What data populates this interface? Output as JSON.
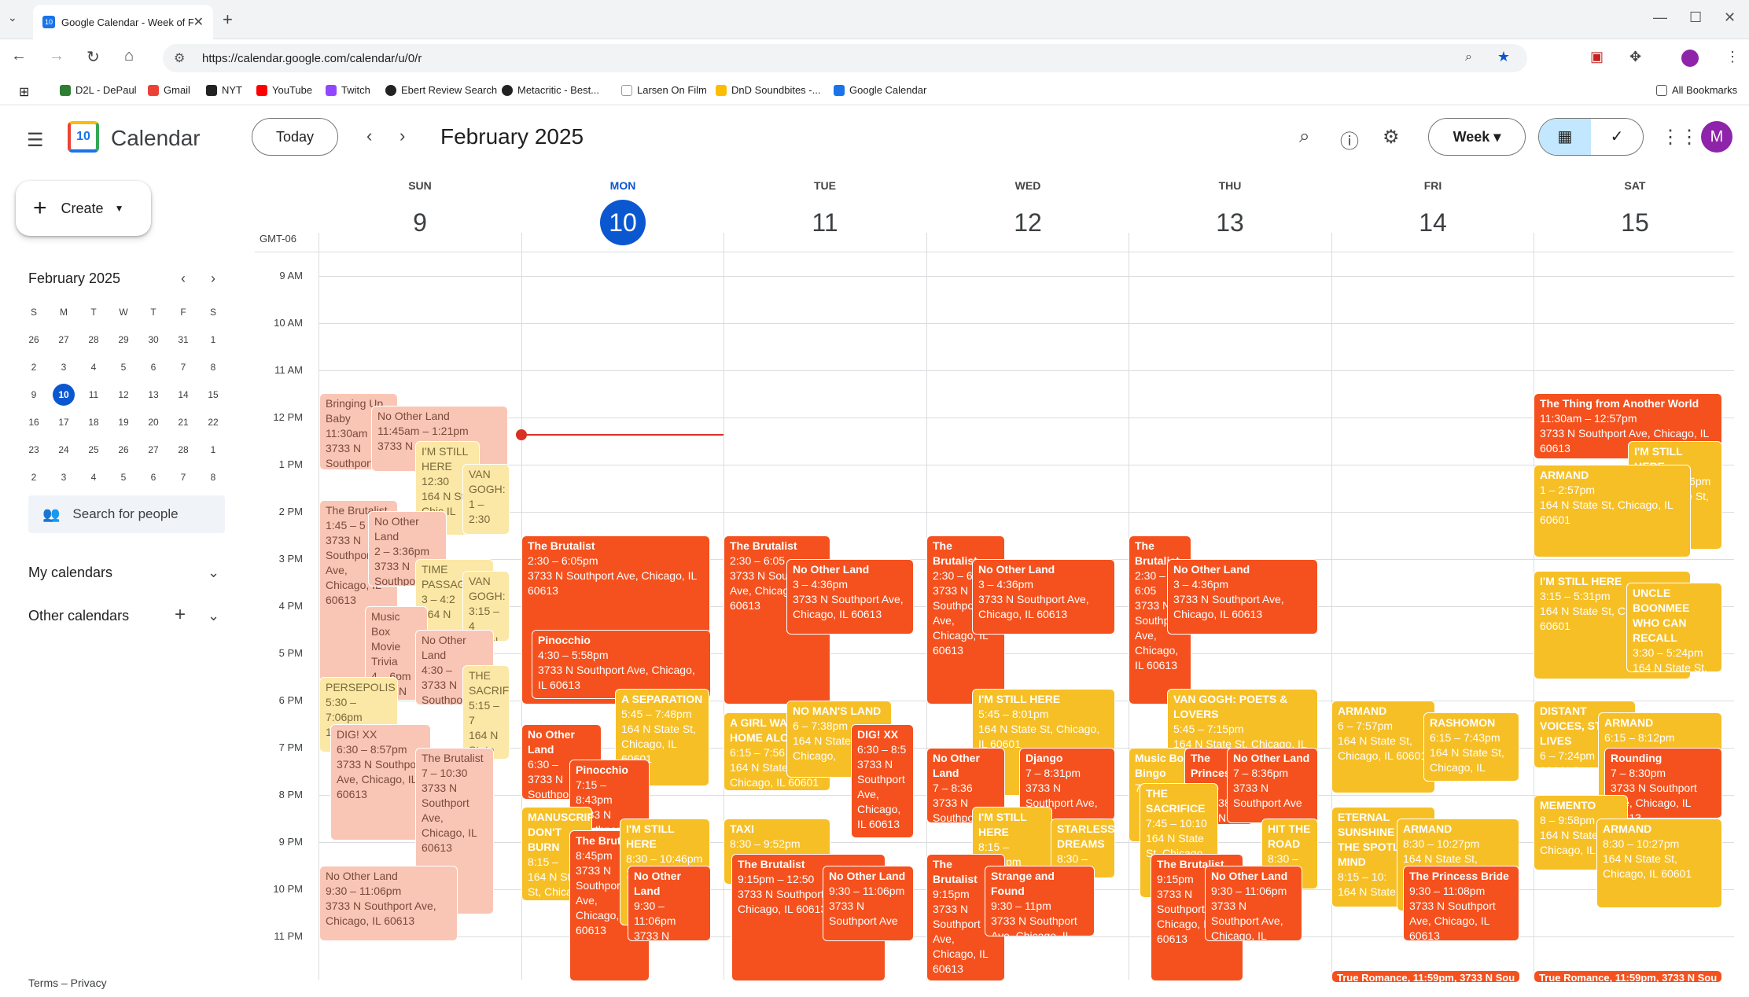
{
  "browser": {
    "tab_title": "Google Calendar - Week of F",
    "url": "https://calendar.google.com/calendar/u/0/r",
    "bookmarks": [
      "D2L - DePaul",
      "Gmail",
      "NYT",
      "YouTube",
      "Twitch",
      "Ebert Review Search",
      "Metacritic - Best...",
      "Larsen On Film",
      "DnD Soundbites -...",
      "Google Calendar"
    ],
    "all_bookmarks": "All Bookmarks"
  },
  "header": {
    "app_name": "Calendar",
    "logo_day": "10",
    "today": "Today",
    "period": "February 2025",
    "view": "Week",
    "avatar": "M"
  },
  "sidebar": {
    "create": "Create",
    "mini_month": "February 2025",
    "dow": [
      "S",
      "M",
      "T",
      "W",
      "T",
      "F",
      "S"
    ],
    "days": [
      "26",
      "27",
      "28",
      "29",
      "30",
      "31",
      "1",
      "2",
      "3",
      "4",
      "5",
      "6",
      "7",
      "8",
      "9",
      "10",
      "11",
      "12",
      "13",
      "14",
      "15",
      "16",
      "17",
      "18",
      "19",
      "20",
      "21",
      "22",
      "23",
      "24",
      "25",
      "26",
      "27",
      "28",
      "1",
      "2",
      "3",
      "4",
      "5",
      "6",
      "7",
      "8"
    ],
    "search_people": "Search for people",
    "my_calendars": "My calendars",
    "other_calendars": "Other calendars",
    "footer": "Terms – Privacy"
  },
  "grid": {
    "timezone": "GMT-06",
    "days": [
      {
        "dow": "SUN",
        "num": "9"
      },
      {
        "dow": "MON",
        "num": "10"
      },
      {
        "dow": "TUE",
        "num": "11"
      },
      {
        "dow": "WED",
        "num": "12"
      },
      {
        "dow": "THU",
        "num": "13"
      },
      {
        "dow": "FRI",
        "num": "14"
      },
      {
        "dow": "SAT",
        "num": "15"
      }
    ],
    "hours": [
      "9 AM",
      "10 AM",
      "11 AM",
      "12 PM",
      "1 PM",
      "2 PM",
      "3 PM",
      "4 PM",
      "5 PM",
      "6 PM",
      "7 PM",
      "8 PM",
      "9 PM",
      "10 PM",
      "11 PM"
    ]
  },
  "events": [
    {
      "title": "Bringing Up Baby",
      "time": "11:30am",
      "loc": "3733 N Southport"
    },
    {
      "title": "No Other Land",
      "time": "11:45am – 1:21pm",
      "loc": "3733 N Chicago"
    },
    {
      "title": "I'M STILL HERE",
      "time": "12:30",
      "loc": "164 N St, Chic IL 6060"
    },
    {
      "title": "VAN GOGH:",
      "time": "1 – 2:30",
      "loc": ""
    },
    {
      "title": "The Brutalist",
      "time": "1:45 – 5",
      "loc": "3733 N Southport Ave, Chicago, IL 60613"
    },
    {
      "title": "No Other Land",
      "time": "2 – 3:36pm",
      "loc": "3733 N Southport"
    },
    {
      "title": "TIME PASSAGE",
      "time": "3 – 4:2",
      "loc": "164 N"
    },
    {
      "title": "VAN GOGH:",
      "time": "3:15 – 4",
      "loc": "164 N"
    },
    {
      "title": "Music Box Movie Trivia",
      "time": "4 – 6pm",
      "loc": "3733 N Southport Ave,"
    },
    {
      "title": "No Other Land",
      "time": "4:30 –",
      "loc": "3733 N Southport"
    },
    {
      "title": "THE SACRIFICE",
      "time": "5:15 – 7",
      "loc": "164 N State St"
    },
    {
      "title": "PERSEPOLIS",
      "time": "5:30 – 7:06pm",
      "loc": "164 N State"
    },
    {
      "title": "DIG! XX",
      "time": "6:30 – 8:57pm",
      "loc": "3733 N Southport Ave, Chicago, IL 60613"
    },
    {
      "title": "The Brutalist",
      "time": "7 – 10:30",
      "loc": "3733 N Southport Ave, Chicago, IL 60613"
    },
    {
      "title": "No Other Land",
      "time": "9:30 – 11:06pm",
      "loc": "3733 N Southport Ave, Chicago, IL 60613"
    },
    {
      "title": "The Brutalist",
      "time": "2:30 – 6:05pm",
      "loc": "3733 N Southport Ave, Chicago, IL 60613"
    },
    {
      "title": "Pinocchio",
      "time": "4:30 – 5:58pm",
      "loc": "3733 N Southport Ave, Chicago, IL 60613"
    },
    {
      "title": "A SEPARATION",
      "time": "5:45 – 7:48pm",
      "loc": "164 N State St, Chicago, IL 60601"
    },
    {
      "title": "No Other Land",
      "time": "6:30 –",
      "loc": "3733 N Southport"
    },
    {
      "title": "Pinocchio",
      "time": "7:15 – 8:43pm",
      "loc": "3733 N Southport"
    },
    {
      "title": "MANUSCRIPTS DON'T BURN",
      "time": "8:15 –",
      "loc": "164 N State St, Chicago"
    },
    {
      "title": "The Brutalist",
      "time": "8:45pm",
      "loc": "3733 N Southport Ave, Chicago, IL 60613"
    },
    {
      "title": "I'M STILL HERE",
      "time": "8:30 – 10:46pm",
      "loc": "164 N State St,"
    },
    {
      "title": "No Other Land",
      "time": "9:30 – 11:06pm",
      "loc": "3733 N Southport"
    },
    {
      "title": "The Brutalist",
      "time": "2:30 – 6:05",
      "loc": "3733 N Southport Ave, Chicago, IL 60613"
    },
    {
      "title": "No Other Land",
      "time": "3 – 4:36pm",
      "loc": "3733 N Southport Ave, Chicago, IL 60613"
    },
    {
      "title": "A GIRL WALKS HOME ALONE",
      "time": "6:15 – 7:56",
      "loc": "164 N State St, Chicago, IL 60601"
    },
    {
      "title": "NO MAN'S LAND",
      "time": "6 – 7:38pm",
      "loc": "164 N State St, Chicago,"
    },
    {
      "title": "DIG! XX",
      "time": "6:30 – 8:5",
      "loc": "3733 N Southport Ave, Chicago, IL 60613"
    },
    {
      "title": "TAXI",
      "time": "8:30 – 9:52pm",
      "loc": ""
    },
    {
      "title": "The Brutalist",
      "time": "9:15pm – 12:50",
      "loc": "3733 N Southport Ave, Chicago, IL 60613"
    },
    {
      "title": "No Other Land",
      "time": "9:30 – 11:06pm",
      "loc": "3733 N Southport Ave"
    },
    {
      "title": "The Brutalist",
      "time": "2:30 – 6:05",
      "loc": "3733 N Southport Ave, Chicago, IL 60613"
    },
    {
      "title": "No Other Land",
      "time": "3 – 4:36pm",
      "loc": "3733 N Southport Ave, Chicago, IL 60613"
    },
    {
      "title": "I'M STILL HERE",
      "time": "5:45 – 8:01pm",
      "loc": "164 N State St, Chicago, IL 60601"
    },
    {
      "title": "No Other Land",
      "time": "7 – 8:36",
      "loc": "3733 N Southport"
    },
    {
      "title": "Django",
      "time": "7 – 8:31pm",
      "loc": "3733 N Southport Ave,"
    },
    {
      "title": "I'M STILL HERE",
      "time": "8:15 – 10:31pm",
      "loc": "164 N State"
    },
    {
      "title": "STARLESS DREAMS",
      "time": "8:30 – 9:46",
      "loc": "164 N State St"
    },
    {
      "title": "The Brutalist",
      "time": "9:15pm",
      "loc": "3733 N Southport Ave, Chicago, IL 60613"
    },
    {
      "title": "Strange and Found",
      "time": "9:30 – 11pm",
      "loc": "3733 N Southport Ave, Chicago, IL"
    },
    {
      "title": "The Brutalist",
      "time": "2:30 – 6:05",
      "loc": "3733 N Southport Ave, Chicago, IL 60613"
    },
    {
      "title": "No Other Land",
      "time": "3 – 4:36pm",
      "loc": "3733 N Southport Ave, Chicago, IL 60613"
    },
    {
      "title": "VAN GOGH: POETS & LOVERS",
      "time": "5:45 – 7:15pm",
      "loc": "164 N State St, Chicago, IL"
    },
    {
      "title": "Music Box Bingo",
      "time": "7 – 9pm",
      "loc": ""
    },
    {
      "title": "The Princess Bride",
      "time": "7 – 8:38",
      "loc": "3733 N Southport"
    },
    {
      "title": "No Other Land",
      "time": "7 – 8:36pm",
      "loc": "3733 N Southport Ave"
    },
    {
      "title": "THE SACRIFICE",
      "time": "7:45 – 10:10",
      "loc": "164 N State St, Chicago"
    },
    {
      "title": "HIT THE ROAD",
      "time": "8:30 – 10",
      "loc": "164 N State St"
    },
    {
      "title": "The Brutalist",
      "time": "9:15pm",
      "loc": "3733 N Southport Ave, Chicago, IL 60613"
    },
    {
      "title": "No Other Land",
      "time": "9:30 – 11:06pm",
      "loc": "3733 N Southport Ave, Chicago, IL"
    },
    {
      "title": "ARMAND",
      "time": "6 – 7:57pm",
      "loc": "164 N State St, Chicago, IL 60601"
    },
    {
      "title": "RASHOMON",
      "time": "6:15 – 7:43pm",
      "loc": "164 N State St, Chicago, IL"
    },
    {
      "title": "ETERNAL SUNSHINE OF THE SPOTLESS MIND",
      "time": "8:15 – 10:",
      "loc": "164 N State St"
    },
    {
      "title": "ARMAND",
      "time": "8:30 – 10:27pm",
      "loc": "164 N State St,"
    },
    {
      "title": "The Princess Bride",
      "time": "9:30 – 11:08pm",
      "loc": "3733 N Southport Ave, Chicago, IL 60613"
    },
    {
      "title": "True Romance, 11:59pm, 3733 N Sou",
      "time": "",
      "loc": ""
    },
    {
      "title": "The Thing from Another World",
      "time": "11:30am – 12:57pm",
      "loc": "3733 N Southport Ave, Chicago, IL 60613"
    },
    {
      "title": "I'M STILL HERE",
      "time": "12:30 – 2:46pm",
      "loc": "164 N State St, Chicago, IL 60601"
    },
    {
      "title": "ARMAND",
      "time": "1 – 2:57pm",
      "loc": "164 N State St, Chicago, IL 60601"
    },
    {
      "title": "I'M STILL HERE",
      "time": "3:15 – 5:31pm",
      "loc": "164 N State St, Chicago, IL 60601"
    },
    {
      "title": "UNCLE BOONMEE WHO CAN RECALL",
      "time": "3:30 – 5:24pm",
      "loc": "164 N State St, Chicago, IL"
    },
    {
      "title": "DISTANT VOICES, STILL LIVES",
      "time": "6 – 7:24pm",
      "loc": "164 N State"
    },
    {
      "title": "ARMAND",
      "time": "6:15 – 8:12pm",
      "loc": "164 N State St, Chicago, IL"
    },
    {
      "title": "Rounding",
      "time": "7 – 8:30pm",
      "loc": "3733 N Southport Ave, Chicago, IL 60613"
    },
    {
      "title": "MEMENTO",
      "time": "8 – 9:58pm",
      "loc": "164 N State St, Chicago, IL"
    },
    {
      "title": "ARMAND",
      "time": "8:30 – 10:27pm",
      "loc": "164 N State St, Chicago, IL 60601"
    },
    {
      "title": "True Romance, 11:59pm, 3733 N Sou",
      "time": "",
      "loc": ""
    }
  ]
}
